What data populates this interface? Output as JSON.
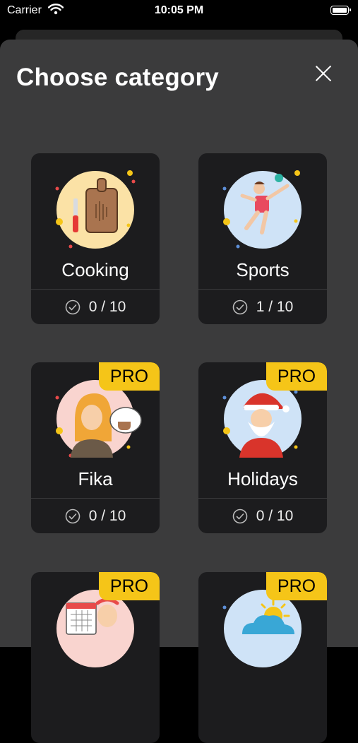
{
  "status": {
    "carrier": "Carrier",
    "time": "10:05 PM"
  },
  "sheet": {
    "title": "Choose category"
  },
  "categories": [
    {
      "name": "Cooking",
      "progress": "0 / 10",
      "pro": ""
    },
    {
      "name": "Sports",
      "progress": "1 / 10",
      "pro": ""
    },
    {
      "name": "Fika",
      "progress": "0 / 10",
      "pro": "PRO"
    },
    {
      "name": "Holidays",
      "progress": "0 / 10",
      "pro": "PRO"
    },
    {
      "name": "",
      "progress": "",
      "pro": "PRO"
    },
    {
      "name": "",
      "progress": "",
      "pro": "PRO"
    }
  ],
  "colors": {
    "pro_badge": "#f5c518",
    "sheet": "#3b3b3c",
    "card": "#1c1c1e"
  },
  "icons": [
    "wifi-icon",
    "battery-icon",
    "close-icon",
    "check-circle-icon"
  ]
}
